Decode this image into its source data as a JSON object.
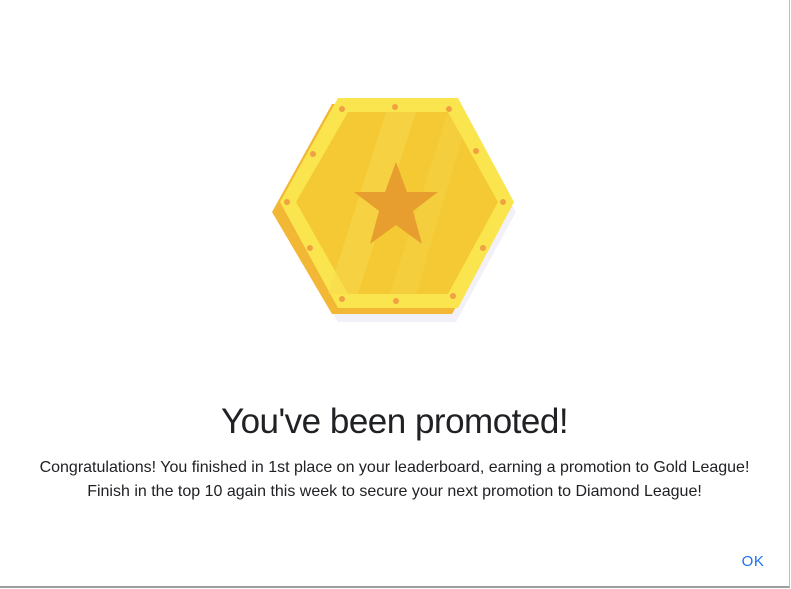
{
  "dialog": {
    "badge_icon": "gold-league-badge-icon",
    "title": "You've been promoted!",
    "message": "Congratulations! You finished in 1st place on your leaderboard, earning a promotion to Gold League! Finish in the top 10 again this week to secure your next promotion to Diamond League!",
    "ok_label": "OK"
  },
  "colors": {
    "badge_outer": "#fbe54f",
    "badge_inner": "#f4c933",
    "badge_shadow": "#f2b734",
    "star": "#e89d2f",
    "rivets": "#f0a142",
    "button_text": "#1a73e8",
    "title_text": "#202124"
  }
}
